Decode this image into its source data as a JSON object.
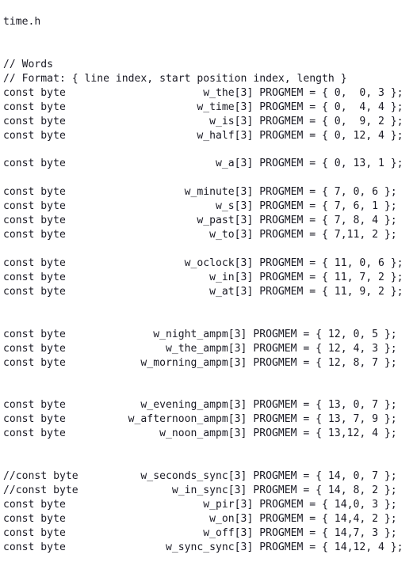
{
  "document": {
    "filename": "time.h",
    "language": "c",
    "font_color": "#1a1a24",
    "background_color": "#ffffff"
  },
  "code": {
    "name_column_end": 33,
    "comments": [
      "// Words",
      "// Format: { line index, start position index, length }"
    ],
    "lines": [
      {
        "type": "text",
        "text": "time.h"
      },
      {
        "type": "blank",
        "text": ""
      },
      {
        "type": "blank",
        "text": ""
      },
      {
        "type": "text",
        "text": "// Words"
      },
      {
        "type": "text",
        "text": "// Format: { line index, start position index, length }"
      },
      {
        "type": "decl",
        "text": "const byte                      w_the[3] PROGMEM = { 0,  0, 3 };"
      },
      {
        "type": "decl",
        "text": "const byte                     w_time[3] PROGMEM = { 0,  4, 4 };"
      },
      {
        "type": "decl",
        "text": "const byte                       w_is[3] PROGMEM = { 0,  9, 2 };"
      },
      {
        "type": "decl",
        "text": "const byte                     w_half[3] PROGMEM = { 0, 12, 4 };"
      },
      {
        "type": "blank",
        "text": ""
      },
      {
        "type": "decl",
        "text": "const byte                        w_a[3] PROGMEM = { 0, 13, 1 };"
      },
      {
        "type": "blank",
        "text": ""
      },
      {
        "type": "decl",
        "text": "const byte                   w_minute[3] PROGMEM = { 7, 0, 6 };"
      },
      {
        "type": "decl",
        "text": "const byte                        w_s[3] PROGMEM = { 7, 6, 1 };"
      },
      {
        "type": "decl",
        "text": "const byte                     w_past[3] PROGMEM = { 7, 8, 4 };"
      },
      {
        "type": "decl",
        "text": "const byte                       w_to[3] PROGMEM = { 7,11, 2 };"
      },
      {
        "type": "blank",
        "text": ""
      },
      {
        "type": "decl",
        "text": "const byte                   w_oclock[3] PROGMEM = { 11, 0, 6 };"
      },
      {
        "type": "decl",
        "text": "const byte                       w_in[3] PROGMEM = { 11, 7, 2 };"
      },
      {
        "type": "decl",
        "text": "const byte                       w_at[3] PROGMEM = { 11, 9, 2 };"
      },
      {
        "type": "blank",
        "text": ""
      },
      {
        "type": "blank",
        "text": ""
      },
      {
        "type": "decl",
        "text": "const byte              w_night_ampm[3] PROGMEM = { 12, 0, 5 };"
      },
      {
        "type": "decl",
        "text": "const byte                w_the_ampm[3] PROGMEM = { 12, 4, 3 };"
      },
      {
        "type": "decl",
        "text": "const byte            w_morning_ampm[3] PROGMEM = { 12, 8, 7 };"
      },
      {
        "type": "blank",
        "text": ""
      },
      {
        "type": "blank",
        "text": ""
      },
      {
        "type": "decl",
        "text": "const byte            w_evening_ampm[3] PROGMEM = { 13, 0, 7 };"
      },
      {
        "type": "decl",
        "text": "const byte          w_afternoon_ampm[3] PROGMEM = { 13, 7, 9 };"
      },
      {
        "type": "decl",
        "text": "const byte               w_noon_ampm[3] PROGMEM = { 13,12, 4 };"
      },
      {
        "type": "blank",
        "text": ""
      },
      {
        "type": "blank",
        "text": ""
      },
      {
        "type": "decl",
        "text": "//const byte          w_seconds_sync[3] PROGMEM = { 14, 0, 7 };"
      },
      {
        "type": "decl",
        "text": "//const byte               w_in_sync[3] PROGMEM = { 14, 8, 2 };"
      },
      {
        "type": "decl",
        "text": "const byte                      w_pir[3] PROGMEM = { 14,0, 3 };"
      },
      {
        "type": "decl",
        "text": "const byte                       w_on[3] PROGMEM = { 14,4, 2 };"
      },
      {
        "type": "decl",
        "text": "const byte                      w_off[3] PROGMEM = { 14,7, 3 };"
      },
      {
        "type": "decl",
        "text": "const byte                w_sync_sync[3] PROGMEM = { 14,12, 4 };"
      }
    ]
  },
  "declarations": [
    {
      "storage": "const byte",
      "name": "w_the",
      "array_size": 3,
      "attribute": "PROGMEM",
      "values": [
        0,
        0,
        3
      ],
      "commented_out": false
    },
    {
      "storage": "const byte",
      "name": "w_time",
      "array_size": 3,
      "attribute": "PROGMEM",
      "values": [
        0,
        4,
        4
      ],
      "commented_out": false
    },
    {
      "storage": "const byte",
      "name": "w_is",
      "array_size": 3,
      "attribute": "PROGMEM",
      "values": [
        0,
        9,
        2
      ],
      "commented_out": false
    },
    {
      "storage": "const byte",
      "name": "w_half",
      "array_size": 3,
      "attribute": "PROGMEM",
      "values": [
        0,
        12,
        4
      ],
      "commented_out": false
    },
    {
      "storage": "const byte",
      "name": "w_a",
      "array_size": 3,
      "attribute": "PROGMEM",
      "values": [
        0,
        13,
        1
      ],
      "commented_out": false
    },
    {
      "storage": "const byte",
      "name": "w_minute",
      "array_size": 3,
      "attribute": "PROGMEM",
      "values": [
        7,
        0,
        6
      ],
      "commented_out": false
    },
    {
      "storage": "const byte",
      "name": "w_s",
      "array_size": 3,
      "attribute": "PROGMEM",
      "values": [
        7,
        6,
        1
      ],
      "commented_out": false
    },
    {
      "storage": "const byte",
      "name": "w_past",
      "array_size": 3,
      "attribute": "PROGMEM",
      "values": [
        7,
        8,
        4
      ],
      "commented_out": false
    },
    {
      "storage": "const byte",
      "name": "w_to",
      "array_size": 3,
      "attribute": "PROGMEM",
      "values": [
        7,
        11,
        2
      ],
      "commented_out": false
    },
    {
      "storage": "const byte",
      "name": "w_oclock",
      "array_size": 3,
      "attribute": "PROGMEM",
      "values": [
        11,
        0,
        6
      ],
      "commented_out": false
    },
    {
      "storage": "const byte",
      "name": "w_in",
      "array_size": 3,
      "attribute": "PROGMEM",
      "values": [
        11,
        7,
        2
      ],
      "commented_out": false
    },
    {
      "storage": "const byte",
      "name": "w_at",
      "array_size": 3,
      "attribute": "PROGMEM",
      "values": [
        11,
        9,
        2
      ],
      "commented_out": false
    },
    {
      "storage": "const byte",
      "name": "w_night_ampm",
      "array_size": 3,
      "attribute": "PROGMEM",
      "values": [
        12,
        0,
        5
      ],
      "commented_out": false
    },
    {
      "storage": "const byte",
      "name": "w_the_ampm",
      "array_size": 3,
      "attribute": "PROGMEM",
      "values": [
        12,
        4,
        3
      ],
      "commented_out": false
    },
    {
      "storage": "const byte",
      "name": "w_morning_ampm",
      "array_size": 3,
      "attribute": "PROGMEM",
      "values": [
        12,
        8,
        7
      ],
      "commented_out": false
    },
    {
      "storage": "const byte",
      "name": "w_evening_ampm",
      "array_size": 3,
      "attribute": "PROGMEM",
      "values": [
        13,
        0,
        7
      ],
      "commented_out": false
    },
    {
      "storage": "const byte",
      "name": "w_afternoon_ampm",
      "array_size": 3,
      "attribute": "PROGMEM",
      "values": [
        13,
        7,
        9
      ],
      "commented_out": false
    },
    {
      "storage": "const byte",
      "name": "w_noon_ampm",
      "array_size": 3,
      "attribute": "PROGMEM",
      "values": [
        13,
        12,
        4
      ],
      "commented_out": false
    },
    {
      "storage": "const byte",
      "name": "w_seconds_sync",
      "array_size": 3,
      "attribute": "PROGMEM",
      "values": [
        14,
        0,
        7
      ],
      "commented_out": true
    },
    {
      "storage": "const byte",
      "name": "w_in_sync",
      "array_size": 3,
      "attribute": "PROGMEM",
      "values": [
        14,
        8,
        2
      ],
      "commented_out": true
    },
    {
      "storage": "const byte",
      "name": "w_pir",
      "array_size": 3,
      "attribute": "PROGMEM",
      "values": [
        14,
        0,
        3
      ],
      "commented_out": false
    },
    {
      "storage": "const byte",
      "name": "w_on",
      "array_size": 3,
      "attribute": "PROGMEM",
      "values": [
        14,
        4,
        2
      ],
      "commented_out": false
    },
    {
      "storage": "const byte",
      "name": "w_off",
      "array_size": 3,
      "attribute": "PROGMEM",
      "values": [
        14,
        7,
        3
      ],
      "commented_out": false
    },
    {
      "storage": "const byte",
      "name": "w_sync_sync",
      "array_size": 3,
      "attribute": "PROGMEM",
      "values": [
        14,
        12,
        4
      ],
      "commented_out": false
    }
  ]
}
